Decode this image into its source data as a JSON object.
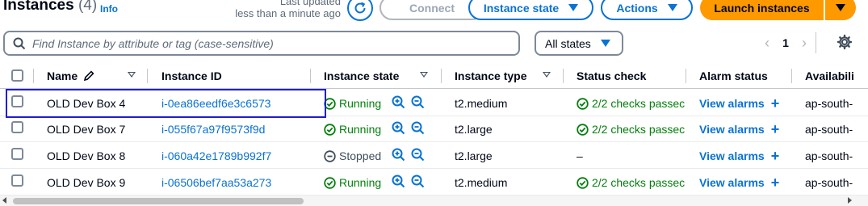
{
  "header": {
    "title": "Instances",
    "count": "(4)",
    "info": "Info",
    "last_updated_label": "Last updated",
    "last_updated_value": "less than a minute ago",
    "connect": "Connect",
    "instance_state": "Instance state",
    "actions": "Actions",
    "launch": "Launch instances"
  },
  "filter": {
    "search_placeholder": "Find Instance by attribute or tag (case-sensitive)",
    "states_selected": "All states"
  },
  "pagination": {
    "page": "1"
  },
  "table": {
    "columns": [
      "Name",
      "Instance ID",
      "Instance state",
      "Instance type",
      "Status check",
      "Alarm status",
      "Availabili"
    ],
    "rows": [
      {
        "name": "OLD Dev Box 4",
        "id": "i-0ea86eedf6e3c6573",
        "state": "Running",
        "type": "t2.medium",
        "check": "2/2 checks passec",
        "alarm": "View alarms",
        "az": "ap-south-"
      },
      {
        "name": "OLD Dev Box 7",
        "id": "i-055f67a97f9573f9d",
        "state": "Running",
        "type": "t2.large",
        "check": "2/2 checks passec",
        "alarm": "View alarms",
        "az": "ap-south-"
      },
      {
        "name": "OLD Dev Box 8",
        "id": "i-060a42e1789b992f7",
        "state": "Stopped",
        "type": "t2.large",
        "check": "–",
        "alarm": "View alarms",
        "az": "ap-south-"
      },
      {
        "name": "OLD Dev Box 9",
        "id": "i-06506bef7aa53a273",
        "state": "Running",
        "type": "t2.medium",
        "check": "2/2 checks passec",
        "alarm": "View alarms",
        "az": "ap-south-"
      }
    ]
  },
  "colors": {
    "link": "#0972d3",
    "running": "#037f0c",
    "stopped": "#414d5c",
    "primary": "#ff9900",
    "highlight": "#1f1fd1"
  }
}
